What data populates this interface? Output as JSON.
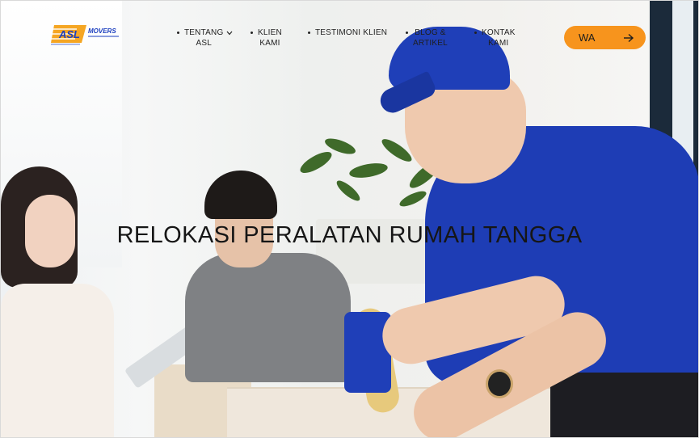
{
  "header": {
    "logo": {
      "name": "ASL",
      "tagline": "MOVERS"
    },
    "nav": [
      {
        "label_line1": "TENTANG",
        "label_line2": "ASL",
        "has_dropdown": true
      },
      {
        "label_line1": "KLIEN",
        "label_line2": "KAMI",
        "has_dropdown": false
      },
      {
        "label_line1": "TESTIMONI KLIEN",
        "label_line2": "",
        "has_dropdown": false
      },
      {
        "label_line1": "BLOG &",
        "label_line2": "ARTIKEL",
        "has_dropdown": false
      },
      {
        "label_line1": "KONTAK",
        "label_line2": "KAMI",
        "has_dropdown": false
      }
    ],
    "cta": {
      "label": "WA",
      "icon": "arrow-right-icon"
    }
  },
  "hero": {
    "title": "RELOKASI PERALATAN RUMAH TANGGA"
  },
  "colors": {
    "accent": "#f7941d",
    "logo_blue": "#1c3fbf",
    "logo_orange": "#f5a623",
    "uniform_blue": "#1f3fb8"
  }
}
